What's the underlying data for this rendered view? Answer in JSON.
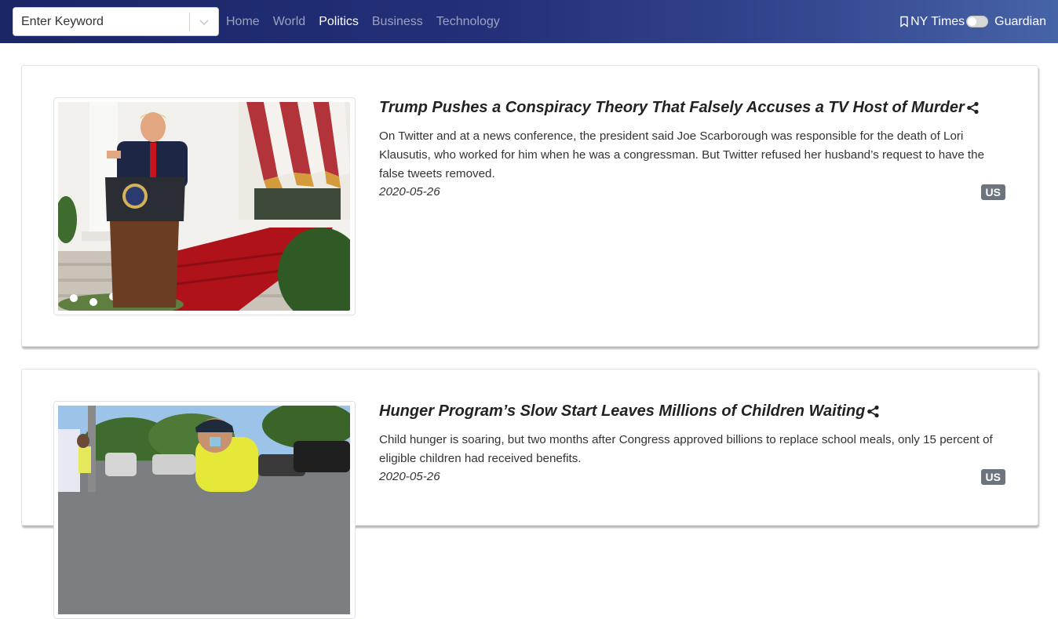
{
  "search": {
    "placeholder": "Enter Keyword"
  },
  "nav": {
    "links": [
      {
        "label": "Home",
        "active": false
      },
      {
        "label": "World",
        "active": false
      },
      {
        "label": "Politics",
        "active": true
      },
      {
        "label": "Business",
        "active": false
      },
      {
        "label": "Technology",
        "active": false
      }
    ]
  },
  "source_toggle": {
    "left_label": "NY Times",
    "right_label": "Guardian",
    "state": "off"
  },
  "articles": [
    {
      "title": "Trump Pushes a Conspiracy Theory That Falsely Accuses a TV Host of Murder",
      "description": "On Twitter and at a news conference, the president said Joe Scarborough was responsible for the death of Lori Klausutis, who worked for him when he was a congressman. But Twitter refused her husband’s request to have the false tweets removed.",
      "date": "2020-05-26",
      "section": "US"
    },
    {
      "title": "Hunger Program’s Slow Start Leaves Millions of Children Waiting",
      "description": "Child hunger is soaring, but two months after Congress approved billions to replace school meals, only 15 percent of eligible children had received benefits.",
      "date": "2020-05-26",
      "section": "US"
    }
  ]
}
